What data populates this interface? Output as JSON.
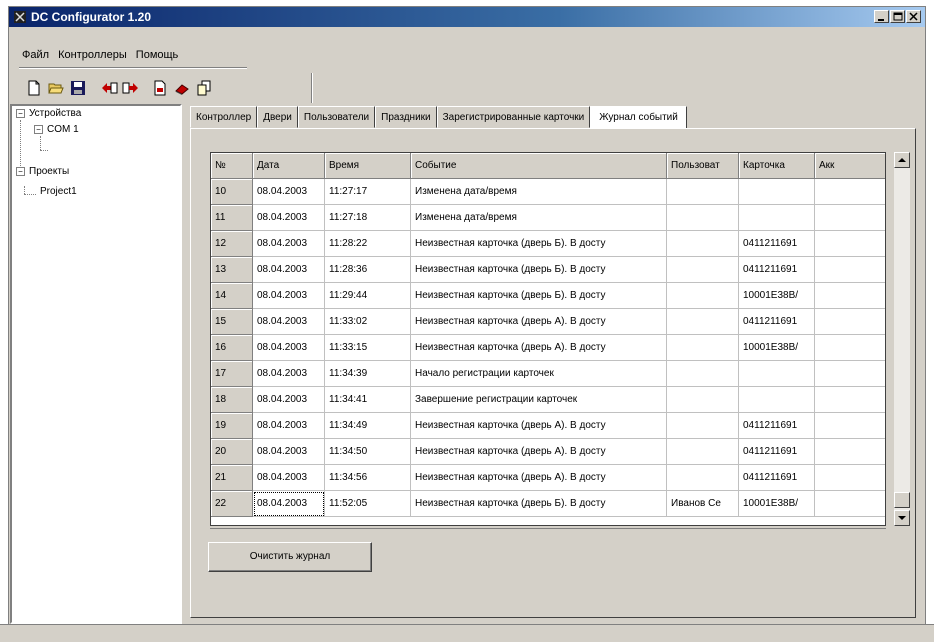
{
  "window": {
    "title": "DC Configurator 1.20"
  },
  "colors": {
    "titlebar_start": "#0a246a",
    "titlebar_end": "#a6caf0",
    "face": "#d4d0c8",
    "toolbar_red": "#c00000"
  },
  "menu": {
    "items": [
      "Файл",
      "Контроллеры",
      "Помощь"
    ]
  },
  "toolbar": {
    "icons": [
      "new-file-icon",
      "open-folder-icon",
      "save-icon",
      "import-icon",
      "export-icon",
      "document-icon",
      "eraser-icon",
      "copy-icon"
    ]
  },
  "tree": {
    "devices_label": "Устройства",
    "com_label": "COM 1",
    "projects_label": "Проекты",
    "project1_label": "Project1"
  },
  "tabs": [
    "Контроллер",
    "Двери",
    "Пользователи",
    "Праздники",
    "Зарегистрированные карточки",
    "Журнал событий"
  ],
  "active_tab": "Журнал событий",
  "table": {
    "headers": [
      "№",
      "Дата",
      "Время",
      "Событие",
      "Пользователь",
      "Карточка",
      "Акк"
    ],
    "header_labels": [
      "№",
      "Дата",
      "Время",
      "Событие",
      "Пользоват",
      "Карточка",
      "Акк"
    ],
    "rows": [
      [
        "10",
        "08.04.2003",
        "11:27:17",
        "Изменена дата/время",
        "",
        "",
        ""
      ],
      [
        "11",
        "08.04.2003",
        "11:27:18",
        "Изменена дата/время",
        "",
        "",
        ""
      ],
      [
        "12",
        "08.04.2003",
        "11:28:22",
        "Неизвестная карточка (дверь Б). В досту",
        "",
        "0411211691",
        ""
      ],
      [
        "13",
        "08.04.2003",
        "11:28:36",
        "Неизвестная карточка (дверь Б). В досту",
        "",
        "0411211691",
        ""
      ],
      [
        "14",
        "08.04.2003",
        "11:29:44",
        "Неизвестная карточка (дверь Б). В досту",
        "",
        "10001E38B/",
        ""
      ],
      [
        "15",
        "08.04.2003",
        "11:33:02",
        "Неизвестная карточка (дверь А). В досту",
        "",
        "0411211691",
        ""
      ],
      [
        "16",
        "08.04.2003",
        "11:33:15",
        "Неизвестная карточка (дверь А). В досту",
        "",
        "10001E38B/",
        ""
      ],
      [
        "17",
        "08.04.2003",
        "11:34:39",
        "Начало регистрации карточек",
        "",
        "",
        ""
      ],
      [
        "18",
        "08.04.2003",
        "11:34:41",
        "Завершение регистрации карточек",
        "",
        "",
        ""
      ],
      [
        "19",
        "08.04.2003",
        "11:34:49",
        "Неизвестная карточка (дверь А). В досту",
        "",
        "0411211691",
        ""
      ],
      [
        "20",
        "08.04.2003",
        "11:34:50",
        "Неизвестная карточка (дверь А). В досту",
        "",
        "0411211691",
        ""
      ],
      [
        "21",
        "08.04.2003",
        "11:34:56",
        "Неизвестная карточка (дверь А). В досту",
        "",
        "0411211691",
        ""
      ],
      [
        "22",
        "08.04.2003",
        "11:52:05",
        "Неизвестная карточка (дверь Б). В досту",
        "Иванов Се",
        "10001E38B/",
        ""
      ]
    ]
  },
  "buttons": {
    "clear_log": "Очистить журнал"
  }
}
